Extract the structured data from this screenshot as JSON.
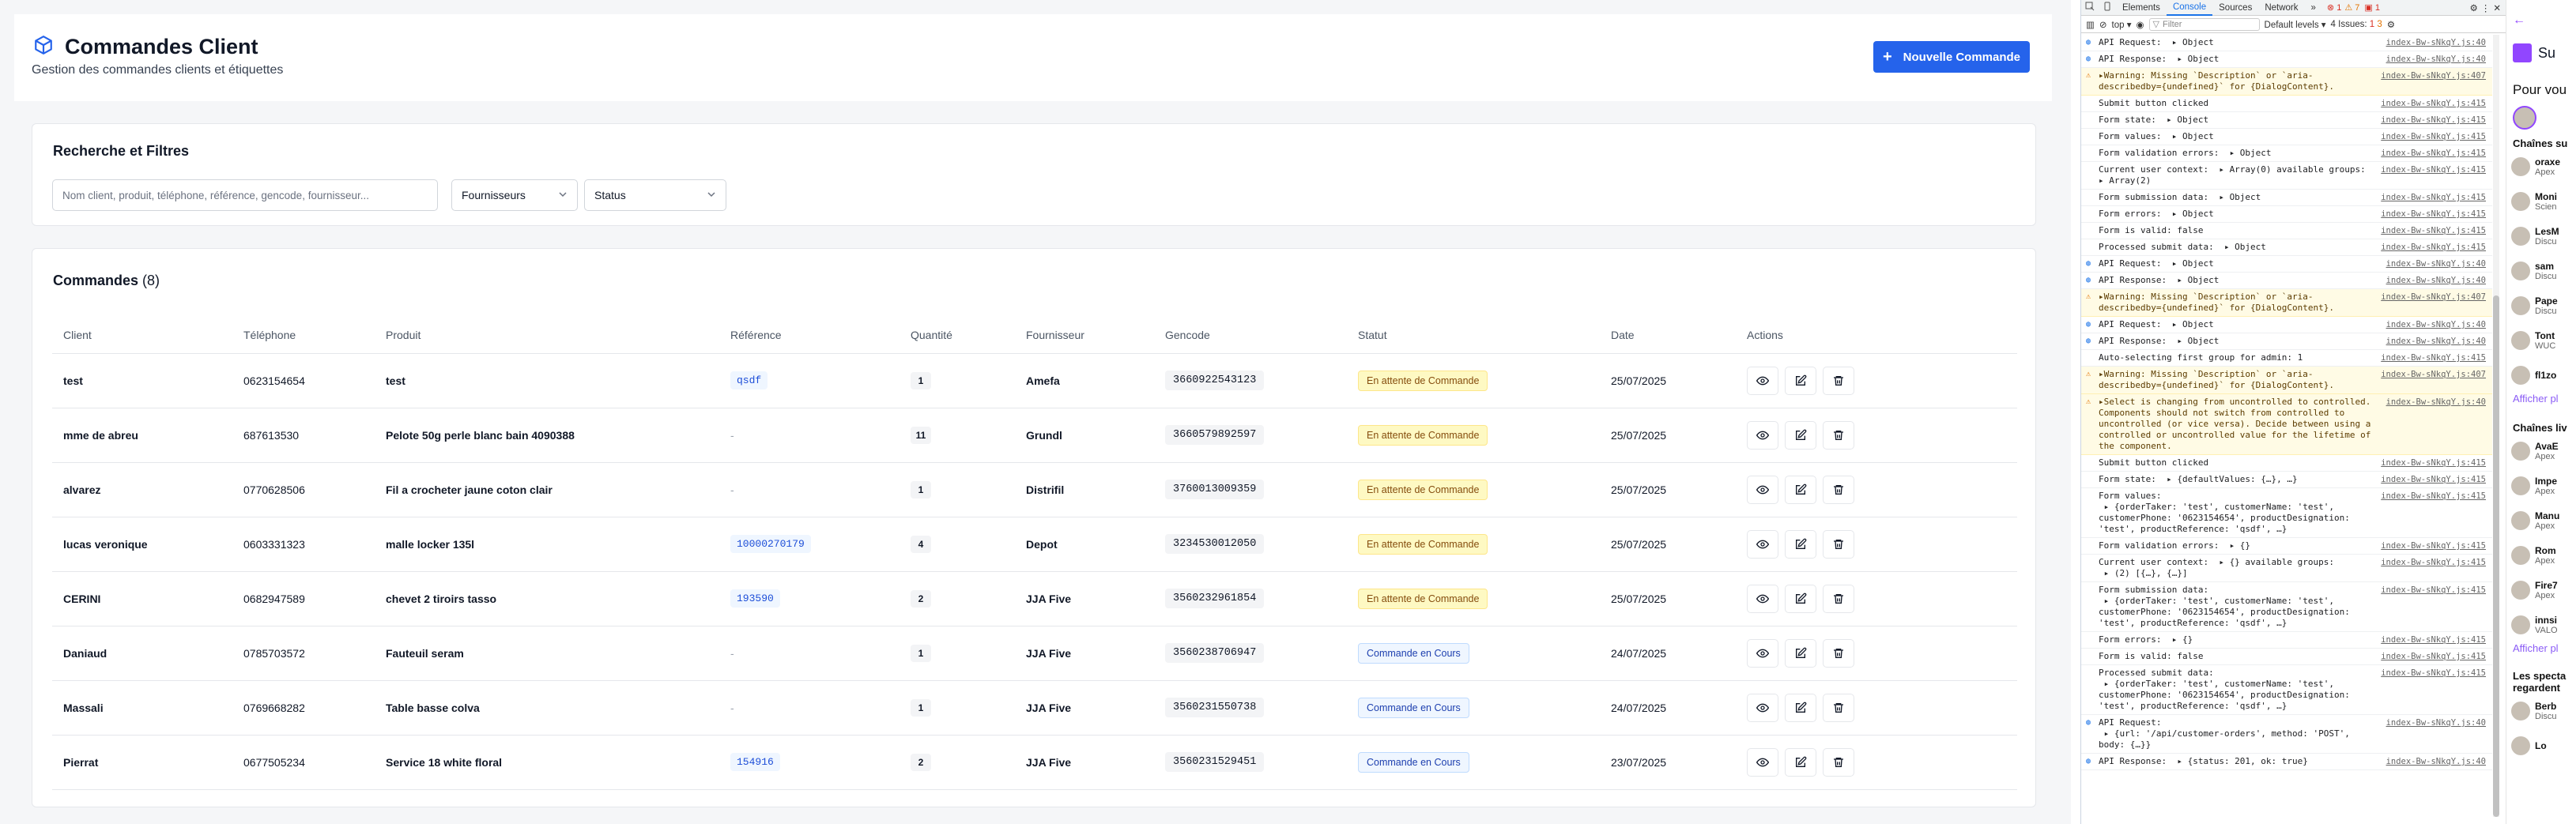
{
  "header": {
    "title": "Commandes Client",
    "subtitle": "Gestion des commandes clients et étiquettes",
    "new_order_label": "Nouvelle Commande"
  },
  "filters": {
    "title": "Recherche et Filtres",
    "search_placeholder": "Nom client, produit, téléphone, référence, gencode, fournisseur...",
    "supplier_select": "Fournisseurs",
    "status_select": "Status"
  },
  "orders": {
    "title": "Commandes",
    "count": "(8)",
    "columns": [
      "Client",
      "Téléphone",
      "Produit",
      "Référence",
      "Quantité",
      "Fournisseur",
      "Gencode",
      "Statut",
      "Date",
      "Actions"
    ],
    "rows": [
      {
        "client": "test",
        "phone": "0623154654",
        "product": "test",
        "reference": "qsdf",
        "quantity": "1",
        "supplier": "Amefa",
        "gencode": "3660922543123",
        "status": "En attente de Commande",
        "status_kind": "wait",
        "date": "25/07/2025"
      },
      {
        "client": "mme de abreu",
        "phone": "687613530",
        "product": "Pelote 50g perle blanc bain 4090388",
        "reference": "-",
        "quantity": "11",
        "supplier": "Grundl",
        "gencode": "3660579892597",
        "status": "En attente de Commande",
        "status_kind": "wait",
        "date": "25/07/2025"
      },
      {
        "client": "alvarez",
        "phone": "0770628506",
        "product": "Fil a crocheter jaune coton clair",
        "reference": "-",
        "quantity": "1",
        "supplier": "Distrifil",
        "gencode": "3760013009359",
        "status": "En attente de Commande",
        "status_kind": "wait",
        "date": "25/07/2025"
      },
      {
        "client": "lucas veronique",
        "phone": "0603331323",
        "product": "malle locker 135l",
        "reference": "10000270179",
        "quantity": "4",
        "supplier": "Depot",
        "gencode": "3234530012050",
        "status": "En attente de Commande",
        "status_kind": "wait",
        "date": "25/07/2025"
      },
      {
        "client": "CERINI",
        "phone": "0682947589",
        "product": "chevet 2 tiroirs tasso",
        "reference": "193590",
        "quantity": "2",
        "supplier": "JJA Five",
        "gencode": "3560232961854",
        "status": "En attente de Commande",
        "status_kind": "wait",
        "date": "25/07/2025"
      },
      {
        "client": "Daniaud",
        "phone": "0785703572",
        "product": "Fauteuil seram",
        "reference": "-",
        "quantity": "1",
        "supplier": "JJA Five",
        "gencode": "3560238706947",
        "status": "Commande en Cours",
        "status_kind": "cours",
        "date": "24/07/2025"
      },
      {
        "client": "Massali",
        "phone": "0769668282",
        "product": "Table basse colva",
        "reference": "-",
        "quantity": "1",
        "supplier": "JJA Five",
        "gencode": "3560231550738",
        "status": "Commande en Cours",
        "status_kind": "cours",
        "date": "24/07/2025"
      },
      {
        "client": "Pierrat",
        "phone": "0677505234",
        "product": "Service 18 white floral",
        "reference": "154916",
        "quantity": "2",
        "supplier": "JJA Five",
        "gencode": "3560231529451",
        "status": "Commande en Cours",
        "status_kind": "cours",
        "date": "23/07/2025"
      }
    ]
  },
  "devtools": {
    "tabs": [
      "Elements",
      "Console",
      "Sources",
      "Network"
    ],
    "active_tab": "Console",
    "more": "»",
    "errors_badge": "1",
    "warnings_badge": "7",
    "issues_errors": "1",
    "context": "top",
    "filter_placeholder": "Filter",
    "levels": "Default levels",
    "issues_label": "4 Issues:",
    "issues_err": "1",
    "issues_warn": "3",
    "logs": [
      {
        "kind": "api",
        "msg": "API Request:  ▸ Object",
        "src": "index-Bw-sNkqY.js:40"
      },
      {
        "kind": "api",
        "msg": "API Response:  ▸ Object",
        "src": "index-Bw-sNkqY.js:40"
      },
      {
        "kind": "warn",
        "msg": "▸Warning: Missing `Description` or `aria-describedby={undefined}` for {DialogContent}.",
        "src": "index-Bw-sNkqY.js:407"
      },
      {
        "kind": "log",
        "msg": "Submit button clicked",
        "src": "index-Bw-sNkqY.js:415"
      },
      {
        "kind": "log",
        "msg": "Form state:  ▸ Object",
        "src": "index-Bw-sNkqY.js:415"
      },
      {
        "kind": "log",
        "msg": "Form values:  ▸ Object",
        "src": "index-Bw-sNkqY.js:415"
      },
      {
        "kind": "log",
        "msg": "Form validation errors:  ▸ Object",
        "src": "index-Bw-sNkqY.js:415"
      },
      {
        "kind": "log",
        "msg": "Current user context:  ▸ Array(0) available groups:\n▸ Array(2)",
        "src": "index-Bw-sNkqY.js:415"
      },
      {
        "kind": "log",
        "msg": "Form submission data:  ▸ Object",
        "src": "index-Bw-sNkqY.js:415"
      },
      {
        "kind": "log",
        "msg": "Form errors:  ▸ Object",
        "src": "index-Bw-sNkqY.js:415"
      },
      {
        "kind": "log",
        "msg": "Form is valid: false",
        "src": "index-Bw-sNkqY.js:415"
      },
      {
        "kind": "log",
        "msg": "Processed submit data:  ▸ Object",
        "src": "index-Bw-sNkqY.js:415"
      },
      {
        "kind": "api",
        "msg": "API Request:  ▸ Object",
        "src": "index-Bw-sNkqY.js:40"
      },
      {
        "kind": "api",
        "msg": "API Response:  ▸ Object",
        "src": "index-Bw-sNkqY.js:40"
      },
      {
        "kind": "warn",
        "msg": "▸Warning: Missing `Description` or `aria-describedby={undefined}` for {DialogContent}.",
        "src": "index-Bw-sNkqY.js:407"
      },
      {
        "kind": "api",
        "msg": "API Request:  ▸ Object",
        "src": "index-Bw-sNkqY.js:40"
      },
      {
        "kind": "api",
        "msg": "API Response:  ▸ Object",
        "src": "index-Bw-sNkqY.js:40"
      },
      {
        "kind": "log",
        "msg": "Auto-selecting first group for admin: 1",
        "src": "index-Bw-sNkqY.js:415"
      },
      {
        "kind": "warn",
        "msg": "▸Warning: Missing `Description` or `aria-describedby={undefined}` for {DialogContent}.",
        "src": "index-Bw-sNkqY.js:407"
      },
      {
        "kind": "warn",
        "msg": "▸Select is changing from uncontrolled to controlled. Components should not switch from controlled to uncontrolled (or vice versa). Decide between using a controlled or uncontrolled value for the lifetime of the component.",
        "src": "index-Bw-sNkqY.js:40"
      },
      {
        "kind": "log",
        "msg": "Submit button clicked",
        "src": "index-Bw-sNkqY.js:415"
      },
      {
        "kind": "log",
        "msg": "Form state:  ▸ {defaultValues: {…}, …}",
        "src": "index-Bw-sNkqY.js:415"
      },
      {
        "kind": "log",
        "msg": "Form values:\n ▸ {orderTaker: 'test', customerName: 'test', customerPhone: '0623154654', productDesignation: 'test', productReference: 'qsdf', …}",
        "src": "index-Bw-sNkqY.js:415"
      },
      {
        "kind": "log",
        "msg": "Form validation errors:  ▸ {}",
        "src": "index-Bw-sNkqY.js:415"
      },
      {
        "kind": "log",
        "msg": "Current user context:  ▸ {} available groups:\n ▸ (2) [{…}, {…}]",
        "src": "index-Bw-sNkqY.js:415"
      },
      {
        "kind": "log",
        "msg": "Form submission data:\n ▸ {orderTaker: 'test', customerName: 'test', customerPhone: '0623154654', productDesignation: 'test', productReference: 'qsdf', …}",
        "src": "index-Bw-sNkqY.js:415"
      },
      {
        "kind": "log",
        "msg": "Form errors:  ▸ {}",
        "src": "index-Bw-sNkqY.js:415"
      },
      {
        "kind": "log",
        "msg": "Form is valid: false",
        "src": "index-Bw-sNkqY.js:415"
      },
      {
        "kind": "log",
        "msg": "Processed submit data:\n ▸ {orderTaker: 'test', customerName: 'test', customerPhone: '0623154654', productDesignation: 'test', productReference: 'qsdf', …}",
        "src": "index-Bw-sNkqY.js:415"
      },
      {
        "kind": "api",
        "msg": "API Request:\n ▸ {url: '/api/customer-orders', method: 'POST', body: {…}}",
        "src": "index-Bw-sNkqY.js:40"
      },
      {
        "kind": "api",
        "msg": "API Response:  ▸ {status: 201, ok: true}",
        "src": "index-Bw-sNkqY.js:40"
      }
    ]
  },
  "twitch": {
    "header": "Su",
    "for_you": "Pour vou",
    "followed_title": "Chaînes su",
    "followed": [
      {
        "name": "oraxe",
        "game": "Apex"
      },
      {
        "name": "Moni",
        "game": "Scien"
      },
      {
        "name": "LesM",
        "game": "Discu"
      },
      {
        "name": "sam",
        "game": "Discu"
      },
      {
        "name": "Pape",
        "game": "Discu"
      },
      {
        "name": "Tont",
        "game": "WUC"
      },
      {
        "name": "fl1zo",
        "game": ""
      }
    ],
    "show_more_1": "Afficher pl",
    "live_title": "Chaînes liv",
    "live": [
      {
        "name": "AvaE",
        "game": "Apex"
      },
      {
        "name": "Impe",
        "game": "Apex"
      },
      {
        "name": "Manu",
        "game": "Apex"
      },
      {
        "name": "Rom",
        "game": "Apex"
      },
      {
        "name": "Fire7",
        "game": "Apex"
      },
      {
        "name": "innsi",
        "game": "VALO"
      }
    ],
    "show_more_2": "Afficher pl",
    "spectators_title": "Les specta regardent",
    "spectators": [
      {
        "name": "Berb",
        "game": "Discu"
      },
      {
        "name": "Lo",
        "game": ""
      }
    ]
  },
  "colors": {
    "primary": "#2563eb",
    "status_wait_bg": "#fef9c3",
    "status_cours_bg": "#eff6ff"
  }
}
